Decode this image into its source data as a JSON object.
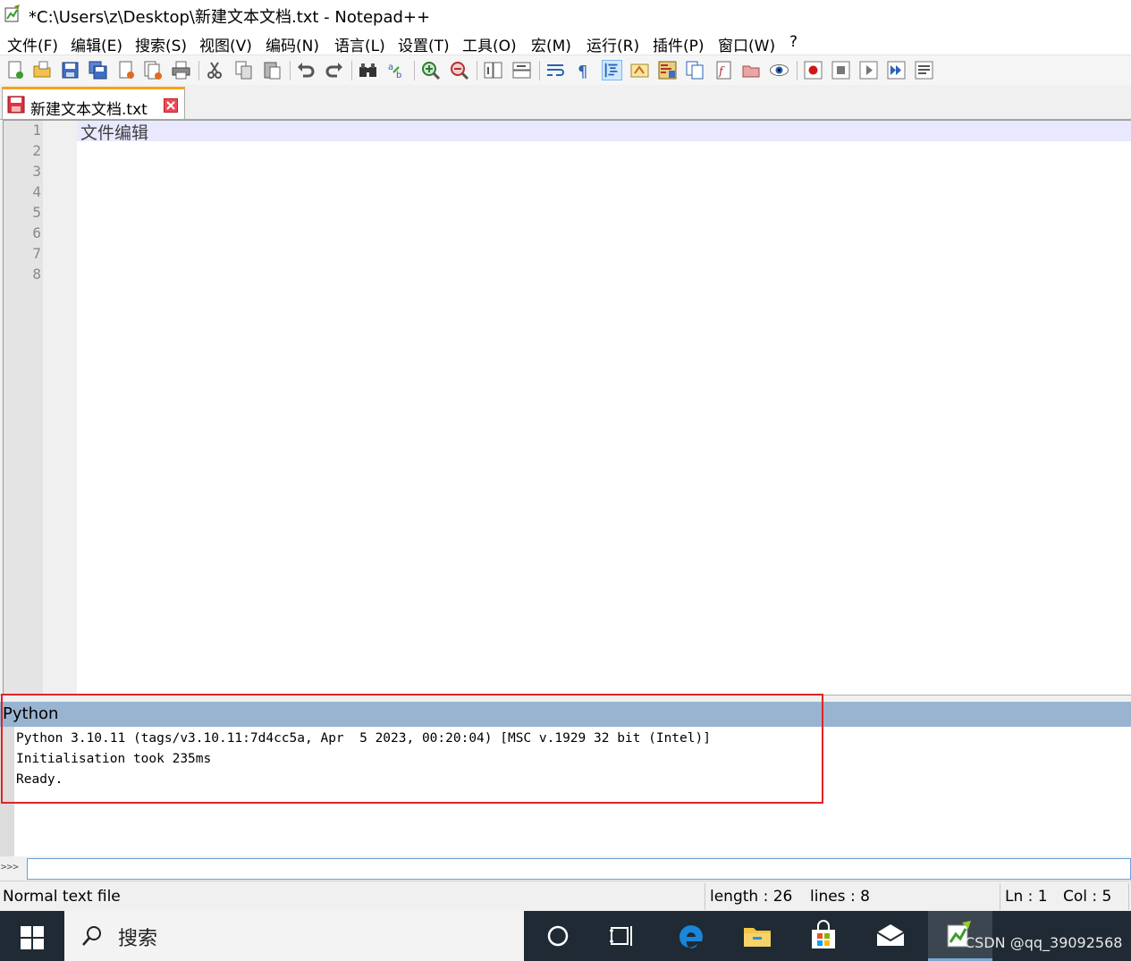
{
  "window": {
    "title": "*C:\\Users\\z\\Desktop\\新建文本文档.txt - Notepad++",
    "app_icon": "notepad-plus-plus-icon"
  },
  "menu": {
    "items": [
      "文件(F)",
      "编辑(E)",
      "搜索(S)",
      "视图(V)",
      "编码(N)",
      "语言(L)",
      "设置(T)",
      "工具(O)",
      "宏(M)",
      "运行(R)",
      "插件(P)",
      "窗口(W)",
      "?"
    ]
  },
  "toolbar": {
    "icons": [
      "new-file-icon",
      "open-file-icon",
      "save-icon",
      "save-all-icon",
      "close-icon",
      "close-all-icon",
      "print-icon",
      "cut-icon",
      "copy-icon",
      "paste-icon",
      "undo-icon",
      "redo-icon",
      "find-icon",
      "replace-icon",
      "zoom-in-icon",
      "zoom-out-icon",
      "sync-vertical-icon",
      "sync-horizontal-icon",
      "word-wrap-icon",
      "show-all-chars-icon",
      "indent-guide-icon",
      "user-language-icon",
      "document-map-icon",
      "document-list-icon",
      "function-list-icon",
      "folder-workspace-icon",
      "monitoring-icon",
      "record-macro-icon",
      "stop-record-icon",
      "play-macro-icon",
      "run-macro-multiple-icon",
      "save-macro-icon"
    ]
  },
  "tabs": [
    {
      "label": "新建文本文档.txt",
      "unsaved": true,
      "icon": "unsaved-disk-icon"
    }
  ],
  "editor": {
    "line_numbers": [
      "1",
      "2",
      "3",
      "4",
      "5",
      "6",
      "7",
      "8"
    ],
    "content": "文件编辑",
    "current_line": 1
  },
  "console": {
    "title": "Python",
    "lines": [
      "Python 3.10.11 (tags/v3.10.11:7d4cc5a, Apr  5 2023, 00:20:04) [MSC v.1929 32 bit (Intel)]",
      "Initialisation took 235ms",
      "Ready."
    ],
    "prompt": ">>>",
    "input_value": ""
  },
  "status": {
    "file_type": "Normal text file",
    "length": "length : 26",
    "lines": "lines : 8",
    "ln": "Ln : 1",
    "col": "Col : 5"
  },
  "taskbar": {
    "search_label": "搜索",
    "watermark": "CSDN @qq_39092568",
    "icons": [
      "windows-start-icon",
      "search-icon",
      "cortana-icon",
      "task-view-icon",
      "edge-icon",
      "file-explorer-icon",
      "store-icon",
      "mail-icon",
      "notepad-plus-plus-icon"
    ]
  },
  "colors": {
    "current_line": "#e8e8ff",
    "panel_header": "#99b4d1",
    "tab_accent": "#f6a21a",
    "highlight_box": "#e02424",
    "taskbar": "#1f2a34"
  }
}
